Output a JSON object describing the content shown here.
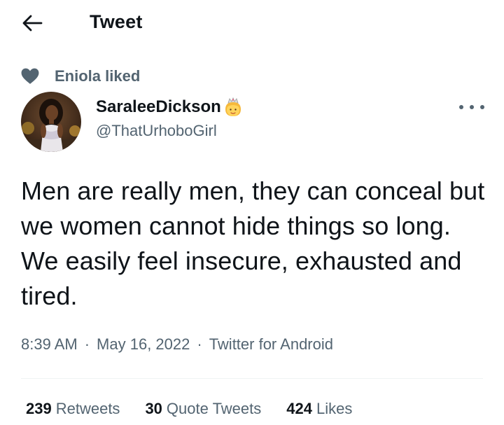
{
  "header": {
    "title": "Tweet",
    "back_icon": "arrow-left-icon"
  },
  "social_context": {
    "icon": "heart-icon",
    "label": "Eniola liked"
  },
  "author": {
    "display_name": "SaraleeDickson",
    "name_emoji": "princess-emoji-icon",
    "handle": "@ThatUrhoboGirl"
  },
  "tweet": {
    "text": "Men are really men, they can conceal but we women cannot hide things so long. We easily feel insecure, exhausted and tired."
  },
  "meta": {
    "time": "8:39 AM",
    "separator": "·",
    "date": "May 16, 2022",
    "source": "Twitter for Android"
  },
  "stats": [
    {
      "count": "239",
      "label": "Retweets"
    },
    {
      "count": "30",
      "label": "Quote Tweets"
    },
    {
      "count": "424",
      "label": "Likes"
    }
  ],
  "colors": {
    "text_primary": "#0f1419",
    "text_secondary": "#536471",
    "divider": "#eff3f4",
    "background": "#ffffff"
  }
}
